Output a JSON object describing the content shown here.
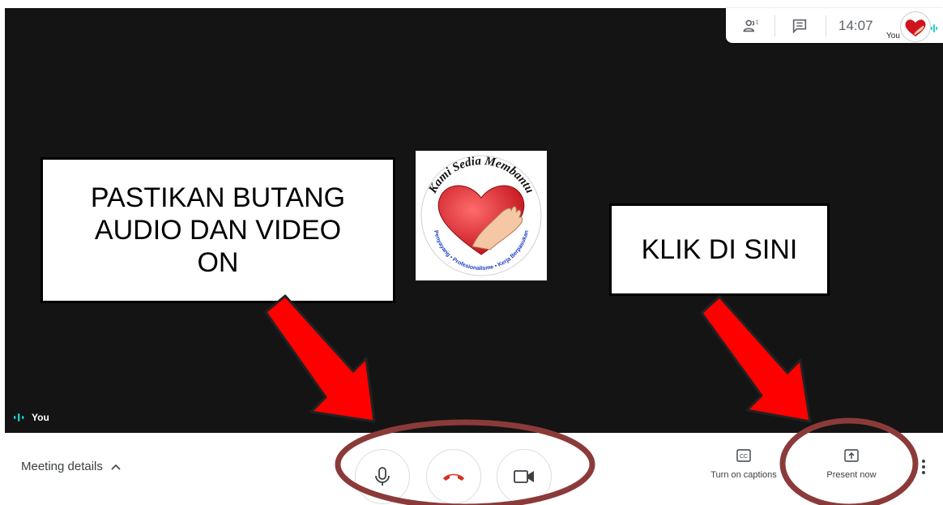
{
  "colors": {
    "stage_bg": "#141414",
    "annotation_red": "#ff0000",
    "ellipse_brown": "#8b3a3a",
    "hangup_red": "#d93025",
    "speaking_teal": "#1ccfc9"
  },
  "topbar": {
    "people_icon": "people-icon",
    "people_count": "1",
    "chat_icon": "chat-icon",
    "time": "14:07",
    "self_label": "You"
  },
  "annotations": {
    "left_callout": "PASTIKAN BUTANG\nAUDIO DAN VIDEO\nON",
    "right_callout": "KLIK DI SINI"
  },
  "logo": {
    "top_text": "Kami Sedia Membantu",
    "bottom_text": "Penyayang • Profesionalisme • Kerja Berpasukan"
  },
  "speaker": {
    "name": "You"
  },
  "controls": {
    "meeting_details": "Meeting details",
    "captions_label": "Turn on captions",
    "present_label": "Present now",
    "captions_icon": "cc-icon",
    "present_icon": "present-icon"
  }
}
